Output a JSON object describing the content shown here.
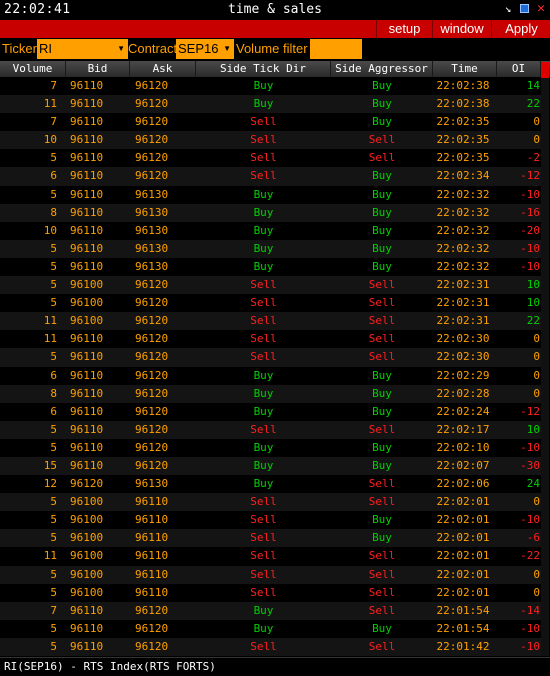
{
  "titlebar": {
    "clock": "22:02:41",
    "title": "time & sales"
  },
  "menu": {
    "setup": "setup",
    "window": "window",
    "apply": "Apply"
  },
  "filters": {
    "ticker_label": "Ticker",
    "ticker_value": "RI",
    "contract_label": "Contract",
    "contract_value": "SEP16",
    "volume_label": "Volume filter",
    "volume_value": ""
  },
  "columns": [
    "Volume",
    "Bid",
    "Ask",
    "Side Tick Dir",
    "Side Aggressor",
    "Time",
    "OI"
  ],
  "colors": {
    "menubar": "#c80000",
    "amber": "#ffa000",
    "buy": "#00d000",
    "sell": "#ff2020"
  },
  "rows": [
    {
      "volume": "7",
      "bid": "96110",
      "ask": "96120",
      "tick": "Buy",
      "aggr": "Buy",
      "time": "22:02:38",
      "oi": "14"
    },
    {
      "volume": "11",
      "bid": "96110",
      "ask": "96120",
      "tick": "Buy",
      "aggr": "Buy",
      "time": "22:02:38",
      "oi": "22"
    },
    {
      "volume": "7",
      "bid": "96110",
      "ask": "96120",
      "tick": "Sell",
      "aggr": "Buy",
      "time": "22:02:35",
      "oi": "0"
    },
    {
      "volume": "10",
      "bid": "96110",
      "ask": "96120",
      "tick": "Sell",
      "aggr": "Sell",
      "time": "22:02:35",
      "oi": "0"
    },
    {
      "volume": "5",
      "bid": "96110",
      "ask": "96120",
      "tick": "Sell",
      "aggr": "Sell",
      "time": "22:02:35",
      "oi": "-2"
    },
    {
      "volume": "6",
      "bid": "96110",
      "ask": "96120",
      "tick": "Sell",
      "aggr": "Buy",
      "time": "22:02:34",
      "oi": "-12"
    },
    {
      "volume": "5",
      "bid": "96110",
      "ask": "96130",
      "tick": "Buy",
      "aggr": "Buy",
      "time": "22:02:32",
      "oi": "-10"
    },
    {
      "volume": "8",
      "bid": "96110",
      "ask": "96130",
      "tick": "Buy",
      "aggr": "Buy",
      "time": "22:02:32",
      "oi": "-16"
    },
    {
      "volume": "10",
      "bid": "96110",
      "ask": "96130",
      "tick": "Buy",
      "aggr": "Buy",
      "time": "22:02:32",
      "oi": "-20"
    },
    {
      "volume": "5",
      "bid": "96110",
      "ask": "96130",
      "tick": "Buy",
      "aggr": "Buy",
      "time": "22:02:32",
      "oi": "-10"
    },
    {
      "volume": "5",
      "bid": "96110",
      "ask": "96130",
      "tick": "Buy",
      "aggr": "Buy",
      "time": "22:02:32",
      "oi": "-10"
    },
    {
      "volume": "5",
      "bid": "96100",
      "ask": "96120",
      "tick": "Sell",
      "aggr": "Sell",
      "time": "22:02:31",
      "oi": "10"
    },
    {
      "volume": "5",
      "bid": "96100",
      "ask": "96120",
      "tick": "Sell",
      "aggr": "Sell",
      "time": "22:02:31",
      "oi": "10"
    },
    {
      "volume": "11",
      "bid": "96100",
      "ask": "96120",
      "tick": "Sell",
      "aggr": "Sell",
      "time": "22:02:31",
      "oi": "22"
    },
    {
      "volume": "11",
      "bid": "96110",
      "ask": "96120",
      "tick": "Sell",
      "aggr": "Sell",
      "time": "22:02:30",
      "oi": "0"
    },
    {
      "volume": "5",
      "bid": "96110",
      "ask": "96120",
      "tick": "Sell",
      "aggr": "Sell",
      "time": "22:02:30",
      "oi": "0"
    },
    {
      "volume": "6",
      "bid": "96110",
      "ask": "96120",
      "tick": "Buy",
      "aggr": "Buy",
      "time": "22:02:29",
      "oi": "0"
    },
    {
      "volume": "8",
      "bid": "96110",
      "ask": "96120",
      "tick": "Buy",
      "aggr": "Buy",
      "time": "22:02:28",
      "oi": "0"
    },
    {
      "volume": "6",
      "bid": "96110",
      "ask": "96120",
      "tick": "Buy",
      "aggr": "Buy",
      "time": "22:02:24",
      "oi": "-12"
    },
    {
      "volume": "5",
      "bid": "96110",
      "ask": "96120",
      "tick": "Sell",
      "aggr": "Sell",
      "time": "22:02:17",
      "oi": "10"
    },
    {
      "volume": "5",
      "bid": "96110",
      "ask": "96120",
      "tick": "Buy",
      "aggr": "Buy",
      "time": "22:02:10",
      "oi": "-10"
    },
    {
      "volume": "15",
      "bid": "96110",
      "ask": "96120",
      "tick": "Buy",
      "aggr": "Buy",
      "time": "22:02:07",
      "oi": "-30"
    },
    {
      "volume": "12",
      "bid": "96120",
      "ask": "96130",
      "tick": "Buy",
      "aggr": "Sell",
      "time": "22:02:06",
      "oi": "24"
    },
    {
      "volume": "5",
      "bid": "96100",
      "ask": "96110",
      "tick": "Sell",
      "aggr": "Sell",
      "time": "22:02:01",
      "oi": "0"
    },
    {
      "volume": "5",
      "bid": "96100",
      "ask": "96110",
      "tick": "Sell",
      "aggr": "Buy",
      "time": "22:02:01",
      "oi": "-10"
    },
    {
      "volume": "5",
      "bid": "96100",
      "ask": "96110",
      "tick": "Sell",
      "aggr": "Buy",
      "time": "22:02:01",
      "oi": "-6"
    },
    {
      "volume": "11",
      "bid": "96100",
      "ask": "96110",
      "tick": "Sell",
      "aggr": "Sell",
      "time": "22:02:01",
      "oi": "-22"
    },
    {
      "volume": "5",
      "bid": "96100",
      "ask": "96110",
      "tick": "Sell",
      "aggr": "Sell",
      "time": "22:02:01",
      "oi": "0"
    },
    {
      "volume": "5",
      "bid": "96100",
      "ask": "96110",
      "tick": "Sell",
      "aggr": "Sell",
      "time": "22:02:01",
      "oi": "0"
    },
    {
      "volume": "7",
      "bid": "96110",
      "ask": "96120",
      "tick": "Buy",
      "aggr": "Sell",
      "time": "22:01:54",
      "oi": "-14"
    },
    {
      "volume": "5",
      "bid": "96110",
      "ask": "96120",
      "tick": "Buy",
      "aggr": "Buy",
      "time": "22:01:54",
      "oi": "-10"
    },
    {
      "volume": "5",
      "bid": "96110",
      "ask": "96120",
      "tick": "Sell",
      "aggr": "Sell",
      "time": "22:01:42",
      "oi": "-10"
    }
  ],
  "status": "RI(SEP16) - RTS Index(RTS FORTS)"
}
